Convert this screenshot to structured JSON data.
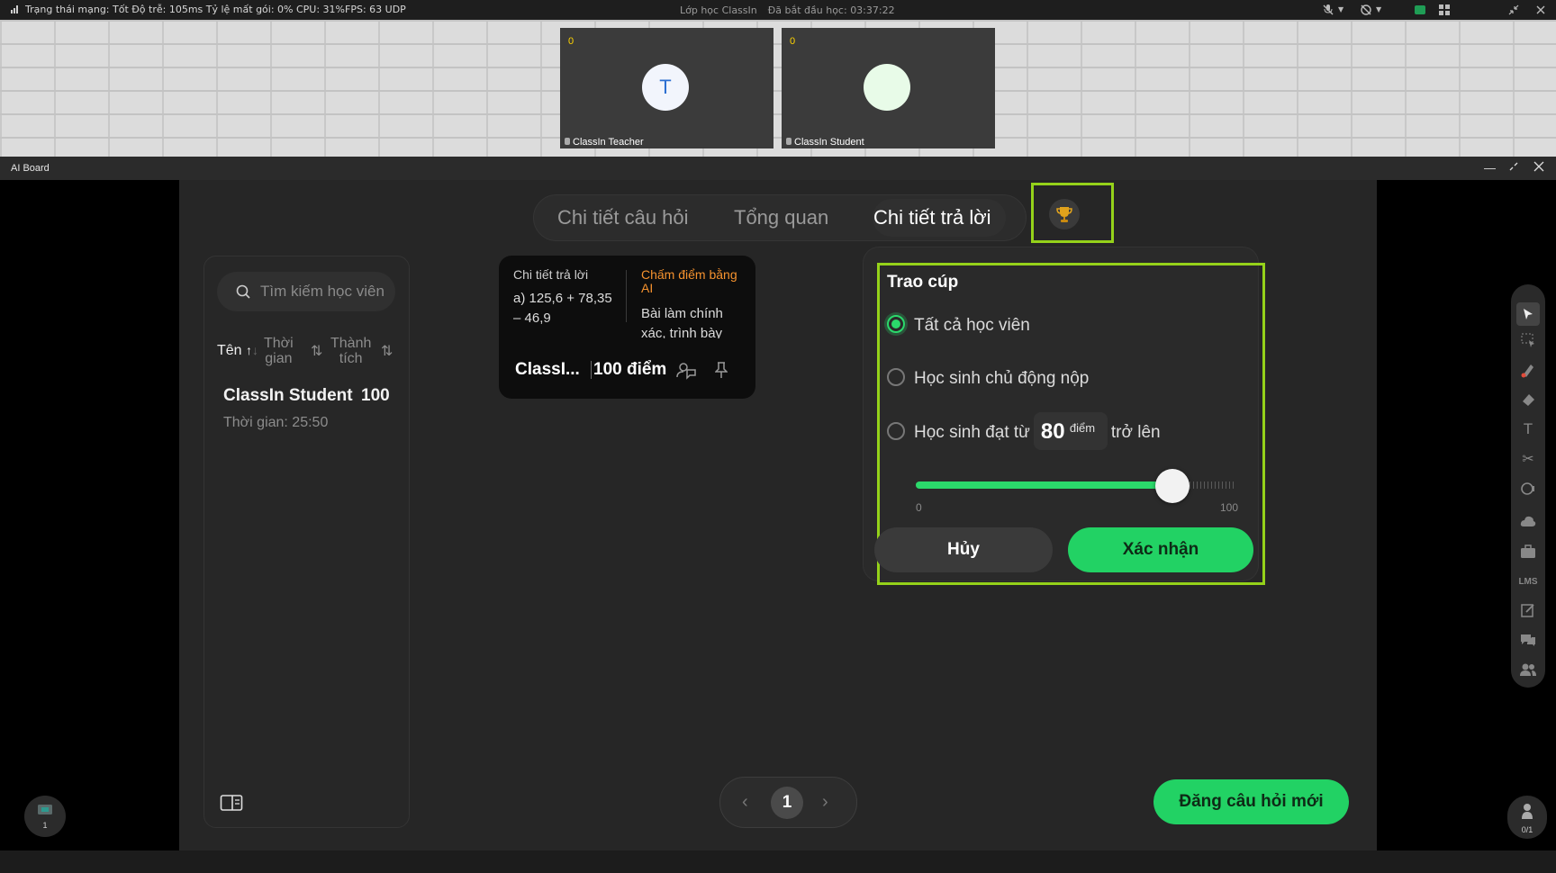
{
  "topbar": {
    "status_text": "Trạng thái mạng: Tốt Độ trễ: 105ms Tỷ lệ mất gói: 0%  CPU: 31%FPS: 63 UDP",
    "classroom": "Lớp học ClassIn",
    "elapsed": "Đã bắt đầu học: 03:37:22",
    "icons": [
      "mic-muted-icon",
      "camera-muted-icon",
      "screen-icon",
      "grid-icon",
      "collapse-icon",
      "close-icon"
    ]
  },
  "video": {
    "teacher": {
      "name": "ClassIn Teacher",
      "score": "0",
      "initial": "T"
    },
    "student": {
      "name": "ClassIn Student",
      "score": "0",
      "initial": ""
    }
  },
  "aiboard": {
    "title": "AI Board",
    "window_controls": [
      "minimize-icon",
      "restore-icon",
      "close-icon"
    ]
  },
  "tabs": [
    {
      "label": "Chi tiết câu hỏi",
      "active": false
    },
    {
      "label": "Tổng quan",
      "active": false
    },
    {
      "label": "Chi tiết trả lời",
      "active": true
    }
  ],
  "leftpanel": {
    "search_placeholder": "Tìm kiếm học viên",
    "headers": {
      "name": "Tên",
      "time_line1": "Thời",
      "time_line2": "gian",
      "score_line1": "Thành",
      "score_line2": "tích"
    },
    "students": [
      {
        "name": "ClassIn Student",
        "score": "100",
        "time": "Thời gian: 25:50"
      }
    ]
  },
  "answer_card": {
    "col_a_title": "Chi tiết trả lời",
    "col_a_body": "a) 125,6 + 78,35 – 46,9",
    "col_b_title": "Chấm điểm bằng AI",
    "col_b_body": "Bài làm chính xác, trình bày",
    "name": "ClassI...",
    "score": "100 điểm"
  },
  "trophy_popup": {
    "title": "Trao cúp",
    "options": [
      {
        "label": "Tất cả học viên",
        "selected": true
      },
      {
        "label": "Học sinh chủ động nộp",
        "selected": false
      },
      {
        "label_before": "Học sinh đạt từ",
        "label_after": "trở lên",
        "selected": false
      }
    ],
    "threshold_value": "80",
    "threshold_unit": "điểm",
    "slider": {
      "min": "0",
      "max": "100",
      "value": 80
    },
    "cancel_label": "Hủy",
    "confirm_label": "Xác nhận"
  },
  "pagination": {
    "current": "1"
  },
  "post_question_label": "Đăng câu hỏi mới",
  "bottom_left_badge": "1",
  "bottom_right_badge": "0/1",
  "colors": {
    "accent": "#22d264",
    "highlight": "#95d21a",
    "orange": "#f5922e"
  }
}
